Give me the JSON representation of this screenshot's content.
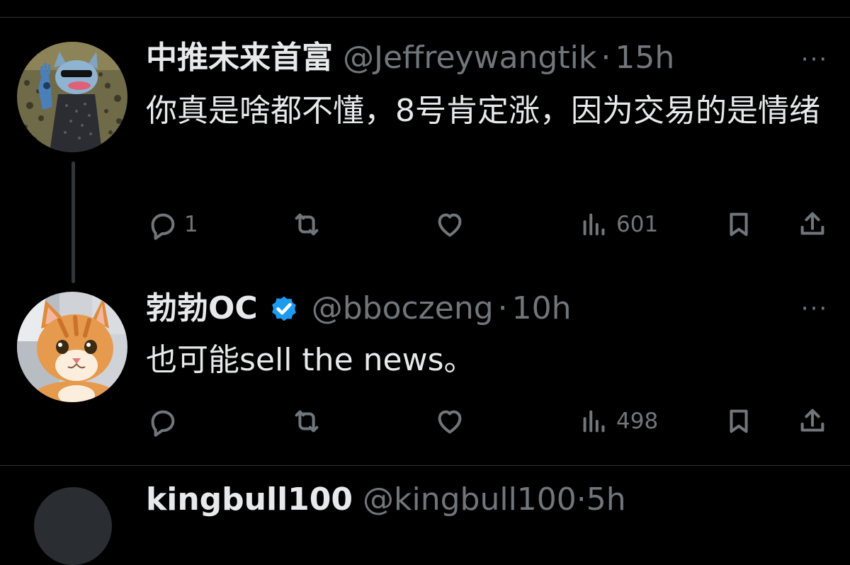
{
  "tweets": [
    {
      "display_name": "中推未来首富",
      "handle": "@Jeffreywangtik",
      "separator": "·",
      "time": "15h",
      "text": "你真是啥都不懂，8号肯定涨，因为交易的是情绪",
      "verified": false,
      "avatar_icon": "cartoon-cat-avatar",
      "actions": {
        "reply_count": "1",
        "retweet_count": "",
        "like_count": "",
        "view_count": "601"
      }
    },
    {
      "display_name": "勃勃OC",
      "handle": "@bboczeng",
      "separator": "·",
      "time": "10h",
      "text": "也可能sell the news。",
      "verified": true,
      "avatar_icon": "orange-cat-photo-avatar",
      "actions": {
        "reply_count": "",
        "retweet_count": "",
        "like_count": "",
        "view_count": "498"
      }
    }
  ],
  "next_tweet": {
    "display_name": "kingbull100",
    "handle": "@kingbull100·5h"
  },
  "more_icon_text": "···",
  "colors": {
    "background": "#000000",
    "primary_text": "#e7e9ea",
    "secondary_text": "#71767b",
    "divider": "#2f3336",
    "verified_blue": "#1d9bf0"
  }
}
